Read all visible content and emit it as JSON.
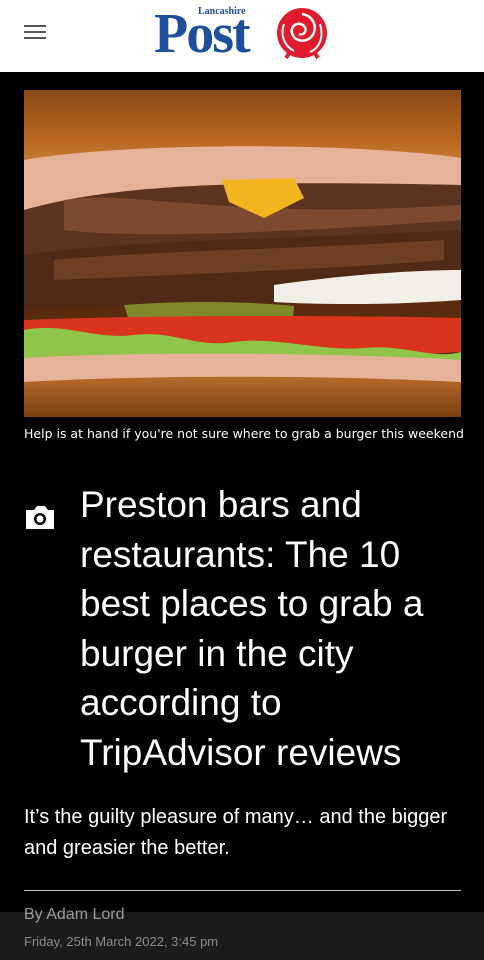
{
  "header": {
    "logo_small": "Lancashire",
    "logo_main": "Post",
    "menu_icon": "hamburger-menu-icon",
    "brand_color": "#1f4f9c",
    "rose_color": "#e11b2e"
  },
  "article": {
    "image_caption": "Help is at hand if you're not sure where to grab a burger this weekend",
    "gallery_icon": "camera-icon",
    "headline": "Preston bars and restaurants: The 10 best places to grab a burger in the city according to TripAdvisor reviews",
    "standfirst": "It’s the guilty pleasure of many… and the bigger and greasier the better.",
    "author": "By Adam Lord",
    "date": "Friday, 25th March 2022, 3:45 pm"
  }
}
